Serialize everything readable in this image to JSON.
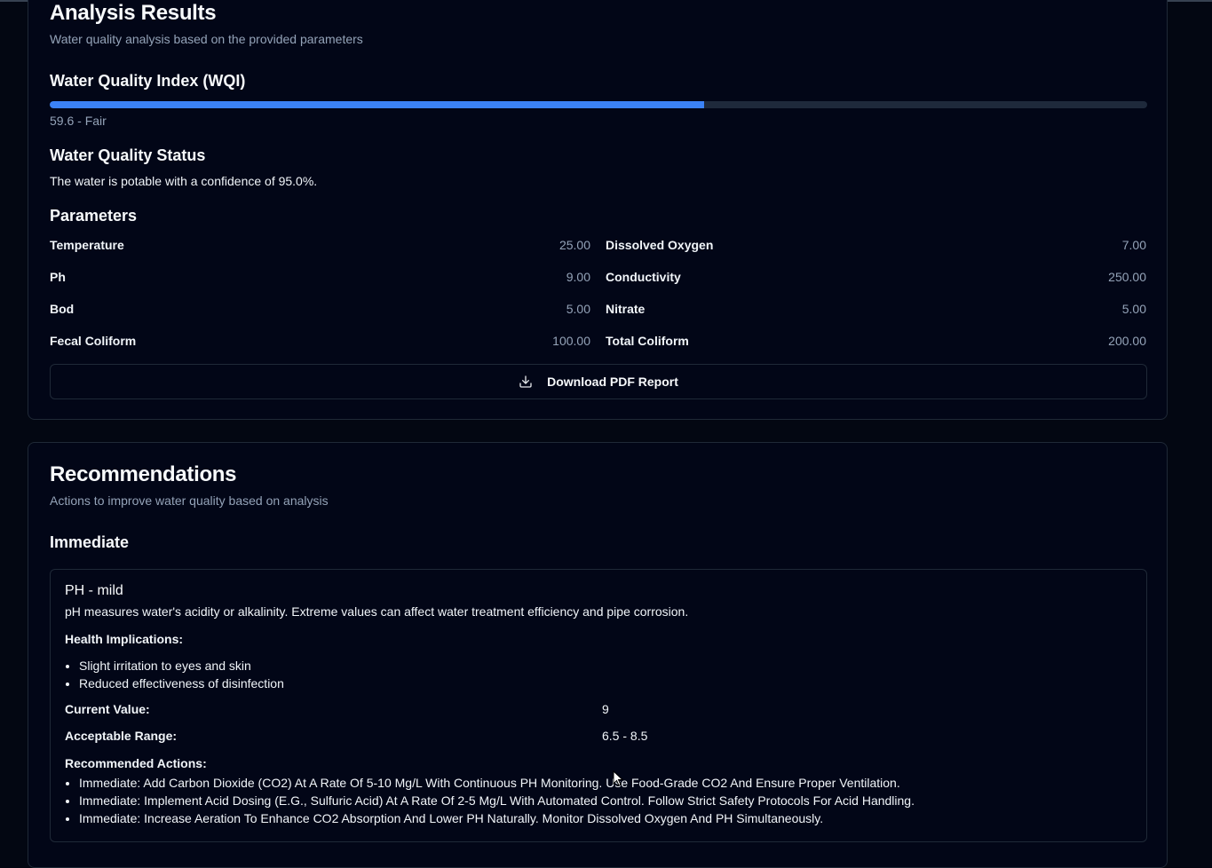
{
  "analysis": {
    "title": "Analysis Results",
    "subtitle": "Water quality analysis based on the provided parameters",
    "wqi": {
      "heading": "Water Quality Index (WQI)",
      "score": 59.6,
      "max": 100,
      "label": "59.6 - Fair",
      "bar_color": "#3b82f6"
    },
    "status": {
      "heading": "Water Quality Status",
      "text": "The water is potable with a confidence of 95.0%."
    },
    "parameters": {
      "heading": "Parameters",
      "left": [
        {
          "label": "Temperature",
          "value": "25.00"
        },
        {
          "label": "Ph",
          "value": "9.00"
        },
        {
          "label": "Bod",
          "value": "5.00"
        },
        {
          "label": "Fecal Coliform",
          "value": "100.00"
        }
      ],
      "right": [
        {
          "label": "Dissolved Oxygen",
          "value": "7.00"
        },
        {
          "label": "Conductivity",
          "value": "250.00"
        },
        {
          "label": "Nitrate",
          "value": "5.00"
        },
        {
          "label": "Total Coliform",
          "value": "200.00"
        }
      ]
    },
    "download_label": "Download PDF Report",
    "download_icon": "download-icon"
  },
  "recommendations": {
    "title": "Recommendations",
    "subtitle": "Actions to improve water quality based on analysis",
    "section": "Immediate",
    "item": {
      "title": "PH - mild",
      "description": "pH measures water's acidity or alkalinity. Extreme values can affect water treatment efficiency and pipe corrosion.",
      "health_label": "Health Implications:",
      "health": [
        "Slight irritation to eyes and skin",
        "Reduced effectiveness of disinfection"
      ],
      "current_label": "Current Value:",
      "current_value": "9",
      "range_label": "Acceptable Range:",
      "range_value": "6.5 - 8.5",
      "actions_label": "Recommended Actions:",
      "actions": [
        "Immediate: Add Carbon Dioxide (CO2) At A Rate Of 5-10 Mg/L With Continuous PH Monitoring. Use Food-Grade CO2 And Ensure Proper Ventilation.",
        "Immediate: Implement Acid Dosing (E.G., Sulfuric Acid) At A Rate Of 2-5 Mg/L With Automated Control. Follow Strict Safety Protocols For Acid Handling.",
        "Immediate: Increase Aeration To Enhance CO2 Absorption And Lower PH Naturally. Monitor Dissolved Oxygen And PH Simultaneously."
      ]
    }
  },
  "colors": {
    "background": "#030712",
    "card": "#020617",
    "border": "#1f2937",
    "accent": "#3b82f6"
  }
}
